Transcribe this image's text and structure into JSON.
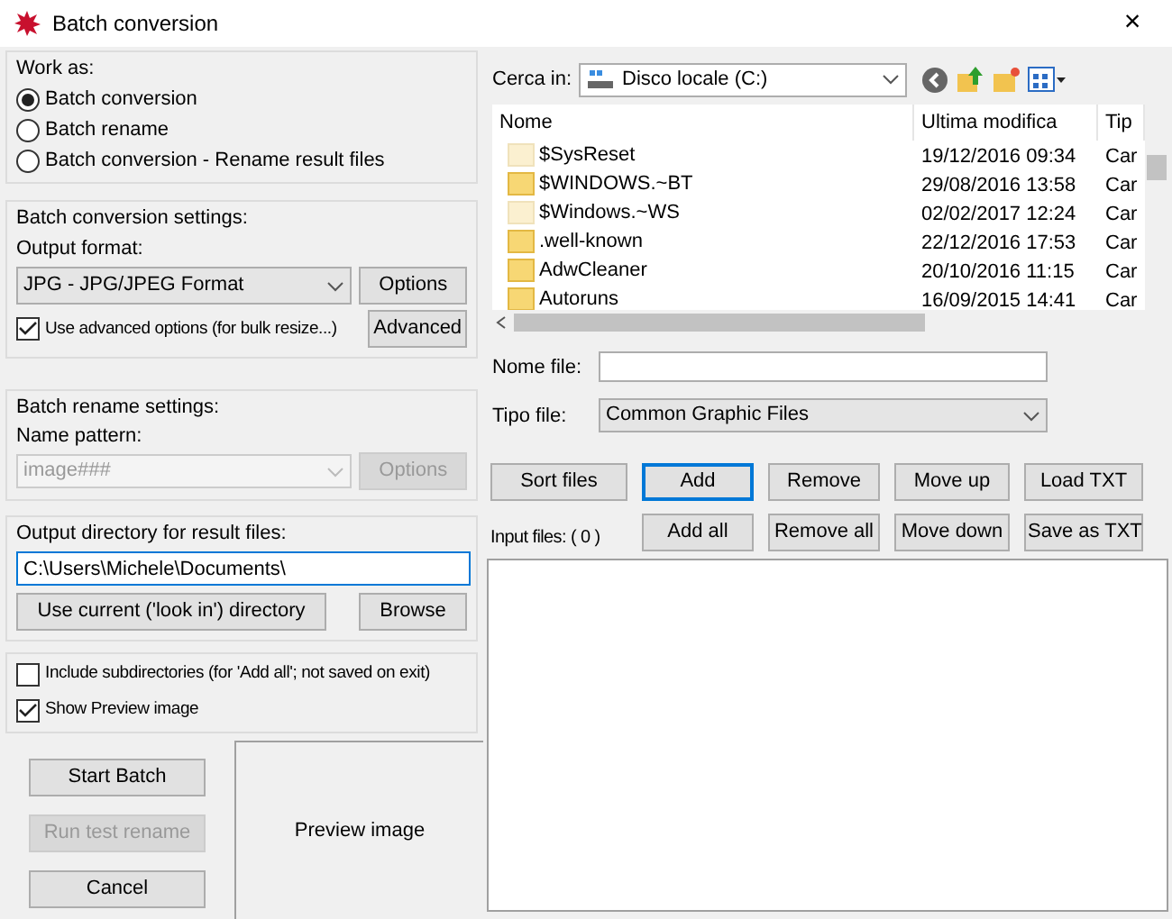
{
  "window": {
    "title": "Batch conversion",
    "close": "×"
  },
  "work_as": {
    "title": "Work as:",
    "options": [
      {
        "label": "Batch conversion",
        "selected": true
      },
      {
        "label": "Batch rename",
        "selected": false
      },
      {
        "label": "Batch conversion - Rename result files",
        "selected": false
      }
    ]
  },
  "conversion_settings": {
    "title": "Batch conversion settings:",
    "format_label": "Output format:",
    "format_value": "JPG - JPG/JPEG Format",
    "options_button": "Options",
    "advanced": {
      "label": "Use advanced options (for bulk resize...)",
      "checked": true
    },
    "advanced_button": "Advanced"
  },
  "rename_settings": {
    "title": "Batch rename settings:",
    "pattern_label": "Name pattern:",
    "pattern_value": "image###",
    "disabled": true,
    "options_button": "Options"
  },
  "output_directory": {
    "title": "Output directory for result files:",
    "value": "C:\\Users\\Michele\\Documents\\",
    "use_current_button": "Use current ('look in') directory",
    "browse_button": "Browse"
  },
  "flags": [
    {
      "label": "Include subdirectories (for 'Add all'; not saved on exit)",
      "checked": false
    },
    {
      "label": "Show Preview image",
      "checked": true
    }
  ],
  "actions": [
    {
      "label": "Start Batch",
      "disabled": false
    },
    {
      "label": "Run test rename",
      "disabled": true
    },
    {
      "label": "Cancel",
      "disabled": false
    }
  ],
  "preview": {
    "label": "Preview image"
  },
  "look_in": {
    "label": "Cerca in:",
    "value": "Disco locale (C:)"
  },
  "file_list": {
    "columns": [
      "Nome",
      "Ultima modifica",
      "Tip"
    ],
    "rows": [
      {
        "name": "$SysReset",
        "modified": "19/12/2016 09:34",
        "type": "Car",
        "hidden": true
      },
      {
        "name": "$WINDOWS.~BT",
        "modified": "29/08/2016 13:58",
        "type": "Car",
        "hidden": false
      },
      {
        "name": "$Windows.~WS",
        "modified": "02/02/2017 12:24",
        "type": "Car",
        "hidden": true
      },
      {
        "name": ".well-known",
        "modified": "22/12/2016 17:53",
        "type": "Car",
        "hidden": false
      },
      {
        "name": "AdwCleaner",
        "modified": "20/10/2016 11:15",
        "type": "Car",
        "hidden": false
      },
      {
        "name": "Autoruns",
        "modified": "16/09/2015 14:41",
        "type": "Car",
        "hidden": false
      }
    ]
  },
  "file_name": {
    "label": "Nome file:"
  },
  "file_type": {
    "label": "Tipo file:",
    "value": "Common Graphic Files"
  },
  "list_buttons": [
    {
      "label": "Sort files",
      "focused": false
    },
    {
      "label": "Add",
      "focused": true
    },
    {
      "label": "Remove",
      "focused": false
    },
    {
      "label": "Move up",
      "focused": false
    },
    {
      "label": "Load TXT",
      "focused": false
    },
    {
      "label": "Add all",
      "focused": false
    },
    {
      "label": "Remove all",
      "focused": false
    },
    {
      "label": "Move down",
      "focused": false
    },
    {
      "label": "Save as TXT",
      "focused": false
    }
  ],
  "input_files": {
    "label": "Input files: ( 0 )"
  }
}
